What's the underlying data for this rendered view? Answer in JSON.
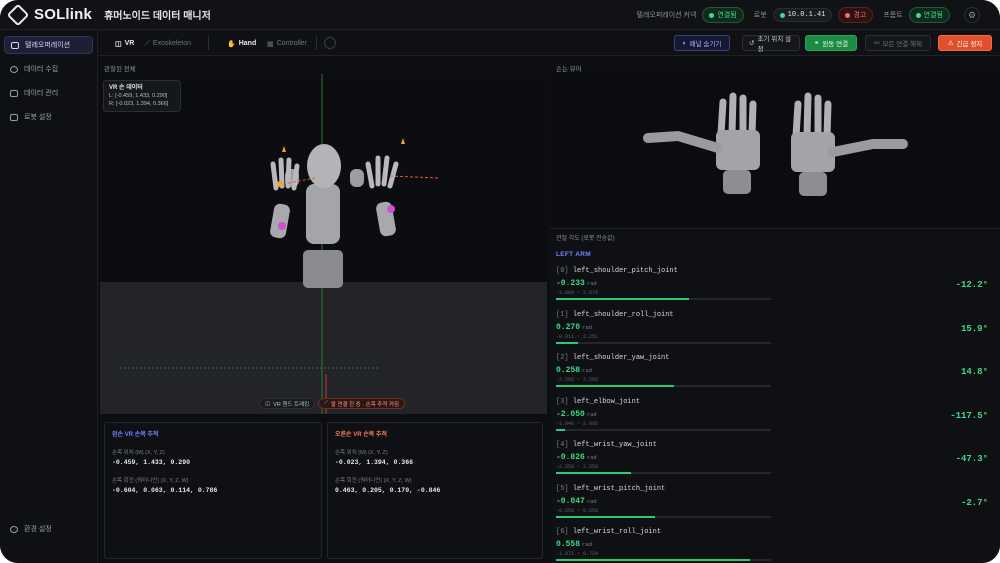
{
  "header": {
    "brand": "SOLlink",
    "app_title": "휴머노이드 데이터 매니저",
    "vr_label": "텔레오퍼레이션 커넥",
    "vr_status": "연결됨",
    "robot_label": "로봇",
    "ip": "10.0.1.41",
    "robot_status": "경고",
    "hand_label": "프롬트",
    "hand_status": "연결됨"
  },
  "sidebar": {
    "items": [
      {
        "label": "텔레오퍼레이션",
        "icon": "gamepad-icon"
      },
      {
        "label": "데이터 수집",
        "icon": "record-icon"
      },
      {
        "label": "데이터 관리",
        "icon": "database-icon"
      },
      {
        "label": "로봇 설정",
        "icon": "sliders-icon"
      }
    ],
    "bottom": {
      "label": "환경 설정",
      "icon": "gear-icon"
    }
  },
  "modebar": {
    "tabs": [
      "VR",
      "Exoskeleton",
      "Hand",
      "Controller"
    ],
    "buttons": {
      "hide": "패널 숨기기",
      "reset": "초기 위치 설정",
      "start": "원동 연결",
      "save": "모든 연결 해제",
      "estop": "긴급 정지"
    }
  },
  "viewport": {
    "label": "관찰된 전체",
    "vr_title": "VR 손 데이터",
    "vr_left": "L: [-0.459, 1.433, 0.290]",
    "vr_right": "R: [-0.023, 1.394, 0.366]",
    "chip_vr": "VR 핸드 트래킹",
    "chip_ctrl": "팔 연결 한 중 · 손목 추적 켜짐"
  },
  "tracking": {
    "left": {
      "title": "왼손 VR 손목 추적",
      "pos_label": "손목 위치 (M) (X, Y, Z)",
      "pos_value": "-0.459, 1.433, 0.290",
      "rot_label": "손목 회전 (쿼터니언) (X, Y, Z, W)",
      "rot_value": "-0.604, 0.063, 0.114, 0.786"
    },
    "right": {
      "title": "오른손 VR 손목 추적",
      "pos_label": "손목 위치 (M) (X, Y, Z)",
      "pos_value": "-0.023, 1.394, 0.366",
      "rot_label": "손목 회전 (쿼터니언) (X, Y, Z, W)",
      "rot_value": "0.463, 0.205, 0.170, -0.846"
    }
  },
  "hands": {
    "label": "손는 뷰어"
  },
  "joints": {
    "title": "관절 각도 (로봇 전송값)",
    "group": "LEFT ARM",
    "unit": "rad",
    "rows": [
      {
        "idx": "[0]",
        "name": "left_shoulder_pitch_joint",
        "value": "-0.233",
        "range": "-3.089 ~ 2.670",
        "deg": "-12.2°",
        "fill": 0.62
      },
      {
        "idx": "[1]",
        "name": "left_shoulder_roll_joint",
        "value": "0.270",
        "range": "-0.011 ~ 2.251",
        "deg": "15.9°",
        "fill": 0.1
      },
      {
        "idx": "[2]",
        "name": "left_shoulder_yaw_joint",
        "value": "0.258",
        "range": "-2.556 ~ 2.556",
        "deg": "14.8°",
        "fill": 0.55
      },
      {
        "idx": "[3]",
        "name": "left_elbow_joint",
        "value": "-2.050",
        "range": "-1.046 ~ 2.095",
        "deg": "-117.5°",
        "fill": 0.04
      },
      {
        "idx": "[4]",
        "name": "left_wrist_yaw_joint",
        "value": "-0.826",
        "range": "-2.556 ~ 2.556",
        "deg": "-47.3°",
        "fill": 0.35
      },
      {
        "idx": "[5]",
        "name": "left_wrist_pitch_joint",
        "value": "-0.047",
        "range": "-0.558 ~ 0.558",
        "deg": "-2.7°",
        "fill": 0.46
      },
      {
        "idx": "[6]",
        "name": "left_wrist_roll_joint",
        "value": "0.558",
        "range": "-1.071 ~ 0.724",
        "deg": "",
        "fill": 0.9
      }
    ]
  }
}
